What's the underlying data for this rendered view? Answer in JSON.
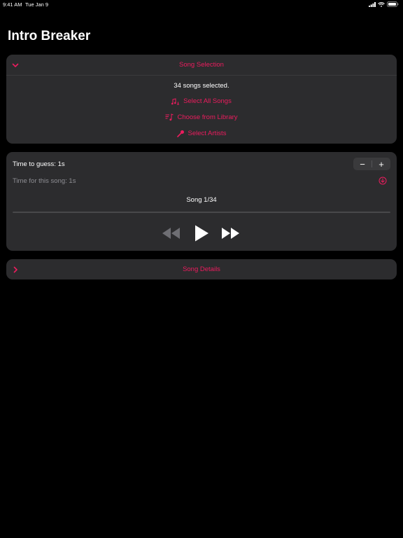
{
  "status_bar": {
    "time": "9:41 AM",
    "date": "Tue Jan 9"
  },
  "app": {
    "title": "Intro Breaker"
  },
  "colors": {
    "accent": "#ec1c5e",
    "card": "#2c2c2e",
    "background": "#000000"
  },
  "song_selection": {
    "header": "Song Selection",
    "expanded": true,
    "count_text": "34 songs selected.",
    "actions": [
      {
        "label": "Select All Songs",
        "icon": "music-notes-icon"
      },
      {
        "label": "Choose from Library",
        "icon": "music-list-icon"
      },
      {
        "label": "Select Artists",
        "icon": "microphone-icon"
      }
    ]
  },
  "player": {
    "time_to_guess_label": "Time to guess: 1s",
    "stepper": {
      "minus": "−",
      "plus": "+"
    },
    "time_for_song_label": "Time for this song: 1s",
    "song_counter": "Song 1/34",
    "progress": 0,
    "controls": [
      "rewind-icon",
      "play-icon",
      "fast-forward-icon"
    ]
  },
  "song_details": {
    "header": "Song Details",
    "expanded": false
  }
}
